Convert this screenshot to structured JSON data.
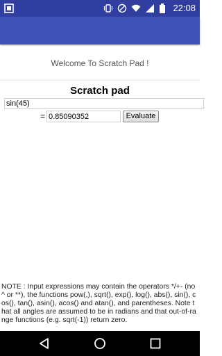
{
  "status_bar": {
    "time": "22:08",
    "icons": [
      "notification-box-icon",
      "vibrate-icon",
      "do-not-disturb-icon",
      "wifi-icon",
      "signal-icon",
      "battery-icon"
    ]
  },
  "welcome": {
    "text": "Welcome To Scratch Pad !"
  },
  "scratch": {
    "title": "Scratch pad",
    "expression_value": "sin(45)",
    "equals": "=",
    "result_value": "0.85090352",
    "evaluate_label": "Evaluate"
  },
  "note": {
    "text": "NOTE : Input expressions may contain the operators */+- (no ^ or **), the functions pow(,), sqrt(), exp(), log(), abs(), sin(), cos(), tan(), asin(), acos() and atan(), and parentheses. Note that all angles are assumed to be in radians and that out-of-range functions (e.g. sqrt(-1)) return zero."
  },
  "nav": {
    "buttons": [
      "back-icon",
      "home-icon",
      "recents-icon"
    ]
  },
  "colors": {
    "status_bar": "#303F9F",
    "app_bar": "#3F51B5",
    "nav_bar": "#000000"
  }
}
